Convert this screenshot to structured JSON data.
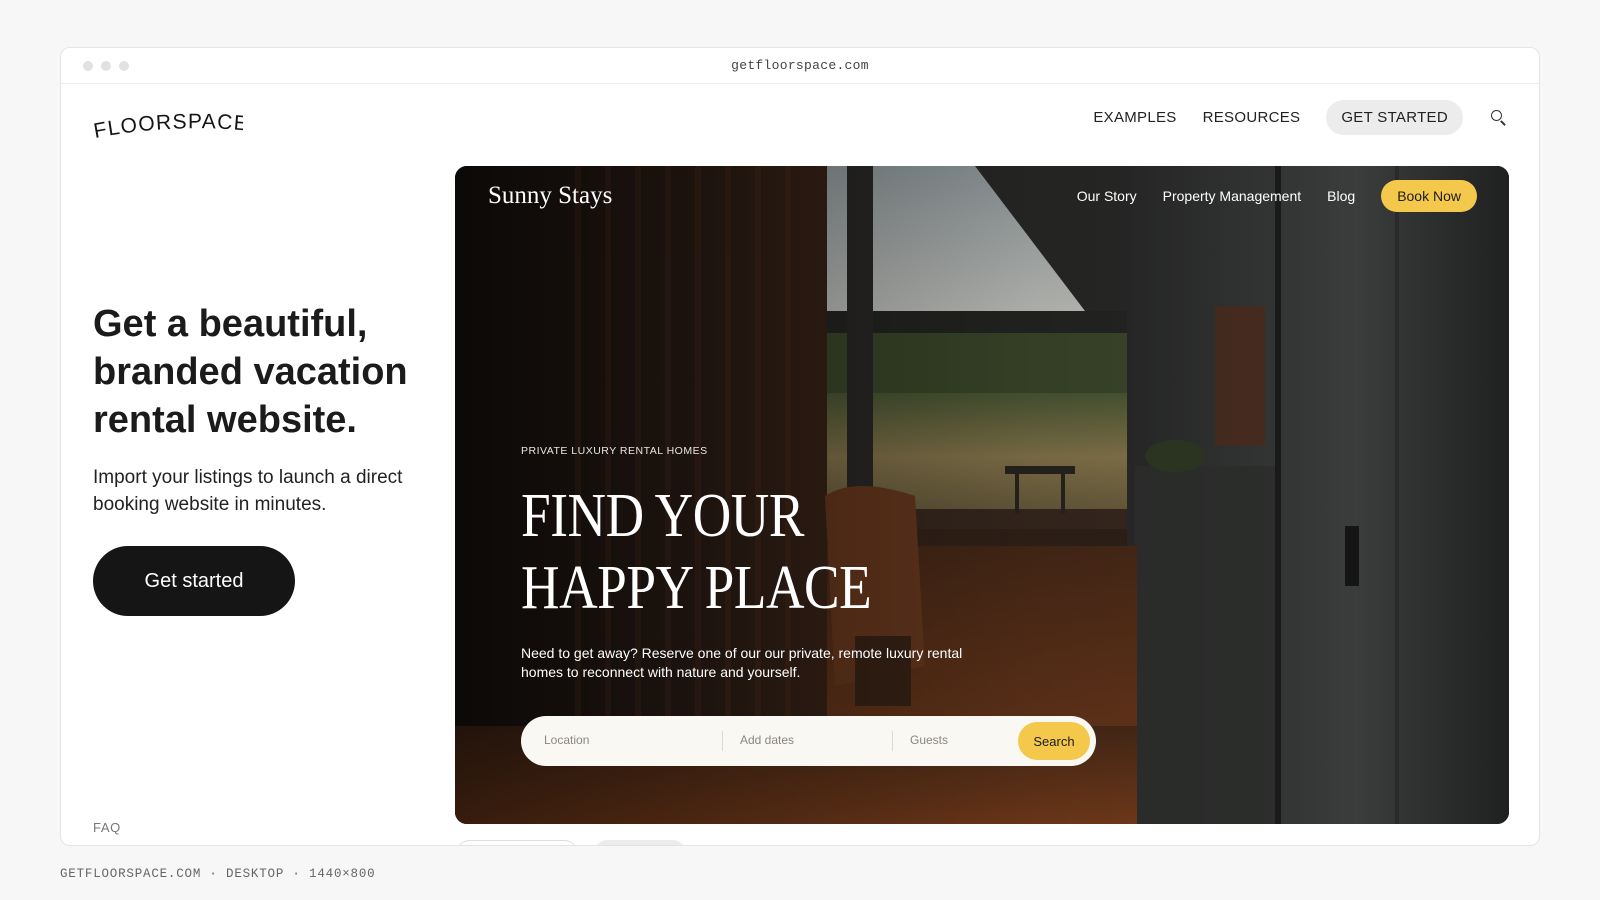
{
  "browser": {
    "url": "getfloorspace.com"
  },
  "site": {
    "logo": "FLOORSPACE",
    "nav": {
      "examples": "EXAMPLES",
      "resources": "RESOURCES",
      "cta": "GET STARTED"
    }
  },
  "hero": {
    "title": "Get a beautiful, branded vacation rental website.",
    "subtitle": "Import your listings to launch a direct booking website in minutes.",
    "button": "Get started"
  },
  "footer_link": "FAQ",
  "preview": {
    "logo": "Sunny Stays",
    "nav": {
      "our_story": "Our Story",
      "property_management": "Property Management",
      "blog": "Blog",
      "book_now": "Book Now"
    },
    "eyebrow": "PRIVATE LUXURY RENTAL HOMES",
    "title_line1": "FIND YOUR",
    "title_line2": "HAPPY PLACE",
    "description": "Need to get away? Reserve one of our our private, remote luxury rental homes to reconnect with nature and yourself.",
    "search": {
      "location": "Location",
      "dates": "Add dates",
      "guests": "Guests",
      "button": "Search"
    }
  },
  "caption": "GETFLOORSPACE.COM · DESKTOP · 1440×800",
  "colors": {
    "accent": "#f3c84b",
    "primary_button": "#151515",
    "page_bg": "#f7f7f7"
  },
  "icons": {
    "search": "search-icon"
  }
}
